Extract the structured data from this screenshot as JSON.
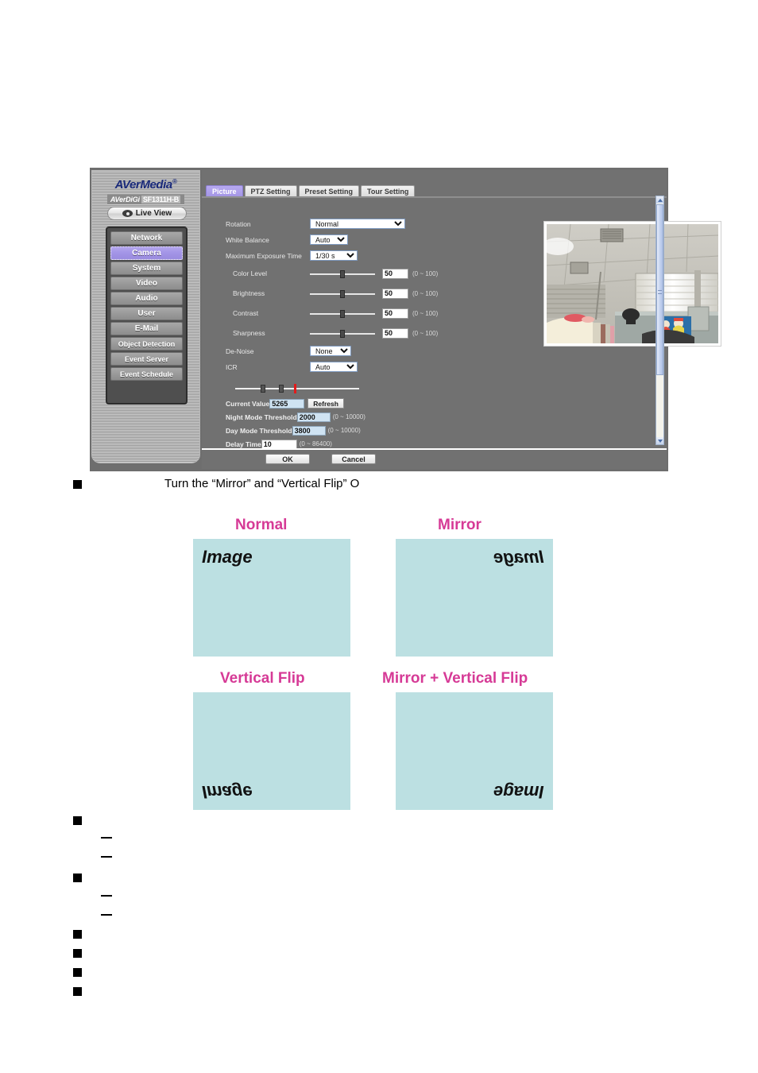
{
  "screenshot": {
    "brand": {
      "main": "AVerMedia",
      "sub_prefix": "AVerDiGi",
      "model": "SF1311H-B"
    },
    "live_view_label": "Live View",
    "sidebar": {
      "items": [
        {
          "label": "Network",
          "active": false
        },
        {
          "label": "Camera",
          "active": true
        },
        {
          "label": "System",
          "active": false
        },
        {
          "label": "Video",
          "active": false
        },
        {
          "label": "Audio",
          "active": false
        },
        {
          "label": "User",
          "active": false
        },
        {
          "label": "E-Mail",
          "active": false
        },
        {
          "label": "Object Detection",
          "active": false
        },
        {
          "label": "Event Server",
          "active": false
        },
        {
          "label": "Event Schedule",
          "active": false
        }
      ]
    },
    "tabs": [
      {
        "label": "Picture",
        "active": true
      },
      {
        "label": "PTZ Setting",
        "active": false
      },
      {
        "label": "Preset Setting",
        "active": false
      },
      {
        "label": "Tour Setting",
        "active": false
      }
    ],
    "form": {
      "rotation": {
        "label": "Rotation",
        "value": "Normal"
      },
      "white_balance": {
        "label": "White Balance",
        "value": "Auto"
      },
      "max_exposure": {
        "label": "Maximum Exposure Time",
        "value": "1/30 s"
      },
      "sliders": [
        {
          "label": "Color Level",
          "value": "50",
          "range": "(0 ~ 100)"
        },
        {
          "label": "Brightness",
          "value": "50",
          "range": "(0 ~ 100)"
        },
        {
          "label": "Contrast",
          "value": "50",
          "range": "(0 ~ 100)"
        },
        {
          "label": "Sharpness",
          "value": "50",
          "range": "(0 ~ 100)"
        }
      ],
      "denoise": {
        "label": "De-Noise",
        "value": "None"
      },
      "icr": {
        "label": "ICR",
        "value": "Auto"
      },
      "thresholds": [
        {
          "label": "Current Value",
          "value": "5265",
          "range": "",
          "button": "Refresh"
        },
        {
          "label": "Night Mode Threshold",
          "value": "2000",
          "range": "(0 ~ 10000)",
          "button": ""
        },
        {
          "label": "Day Mode Threshold",
          "value": "3800",
          "range": "(0 ~ 10000)",
          "button": ""
        },
        {
          "label": "Delay Time",
          "value": "10",
          "range": "(0 ~ 86400)",
          "button": ""
        }
      ]
    },
    "footer": {
      "ok": "OK",
      "cancel": "Cancel"
    },
    "colors": {
      "accent_purple": "#a294e6",
      "panel_gray": "#717171",
      "field_blue": "#cfe3f2"
    }
  },
  "document": {
    "instruction": "Turn the “Mirror” and “Vertical Flip” O",
    "demos": [
      {
        "title": "Normal",
        "word": "Image",
        "flip": "none"
      },
      {
        "title": "Mirror",
        "word": "Image",
        "flip": "horizontal"
      },
      {
        "title": "Vertical Flip",
        "word": "Image",
        "flip": "vertical"
      },
      {
        "title": "Mirror + Vertical Flip",
        "word": "Image",
        "flip": "both"
      }
    ],
    "demo_color": "#d63a96",
    "demo_bg": "#bce0e2"
  }
}
